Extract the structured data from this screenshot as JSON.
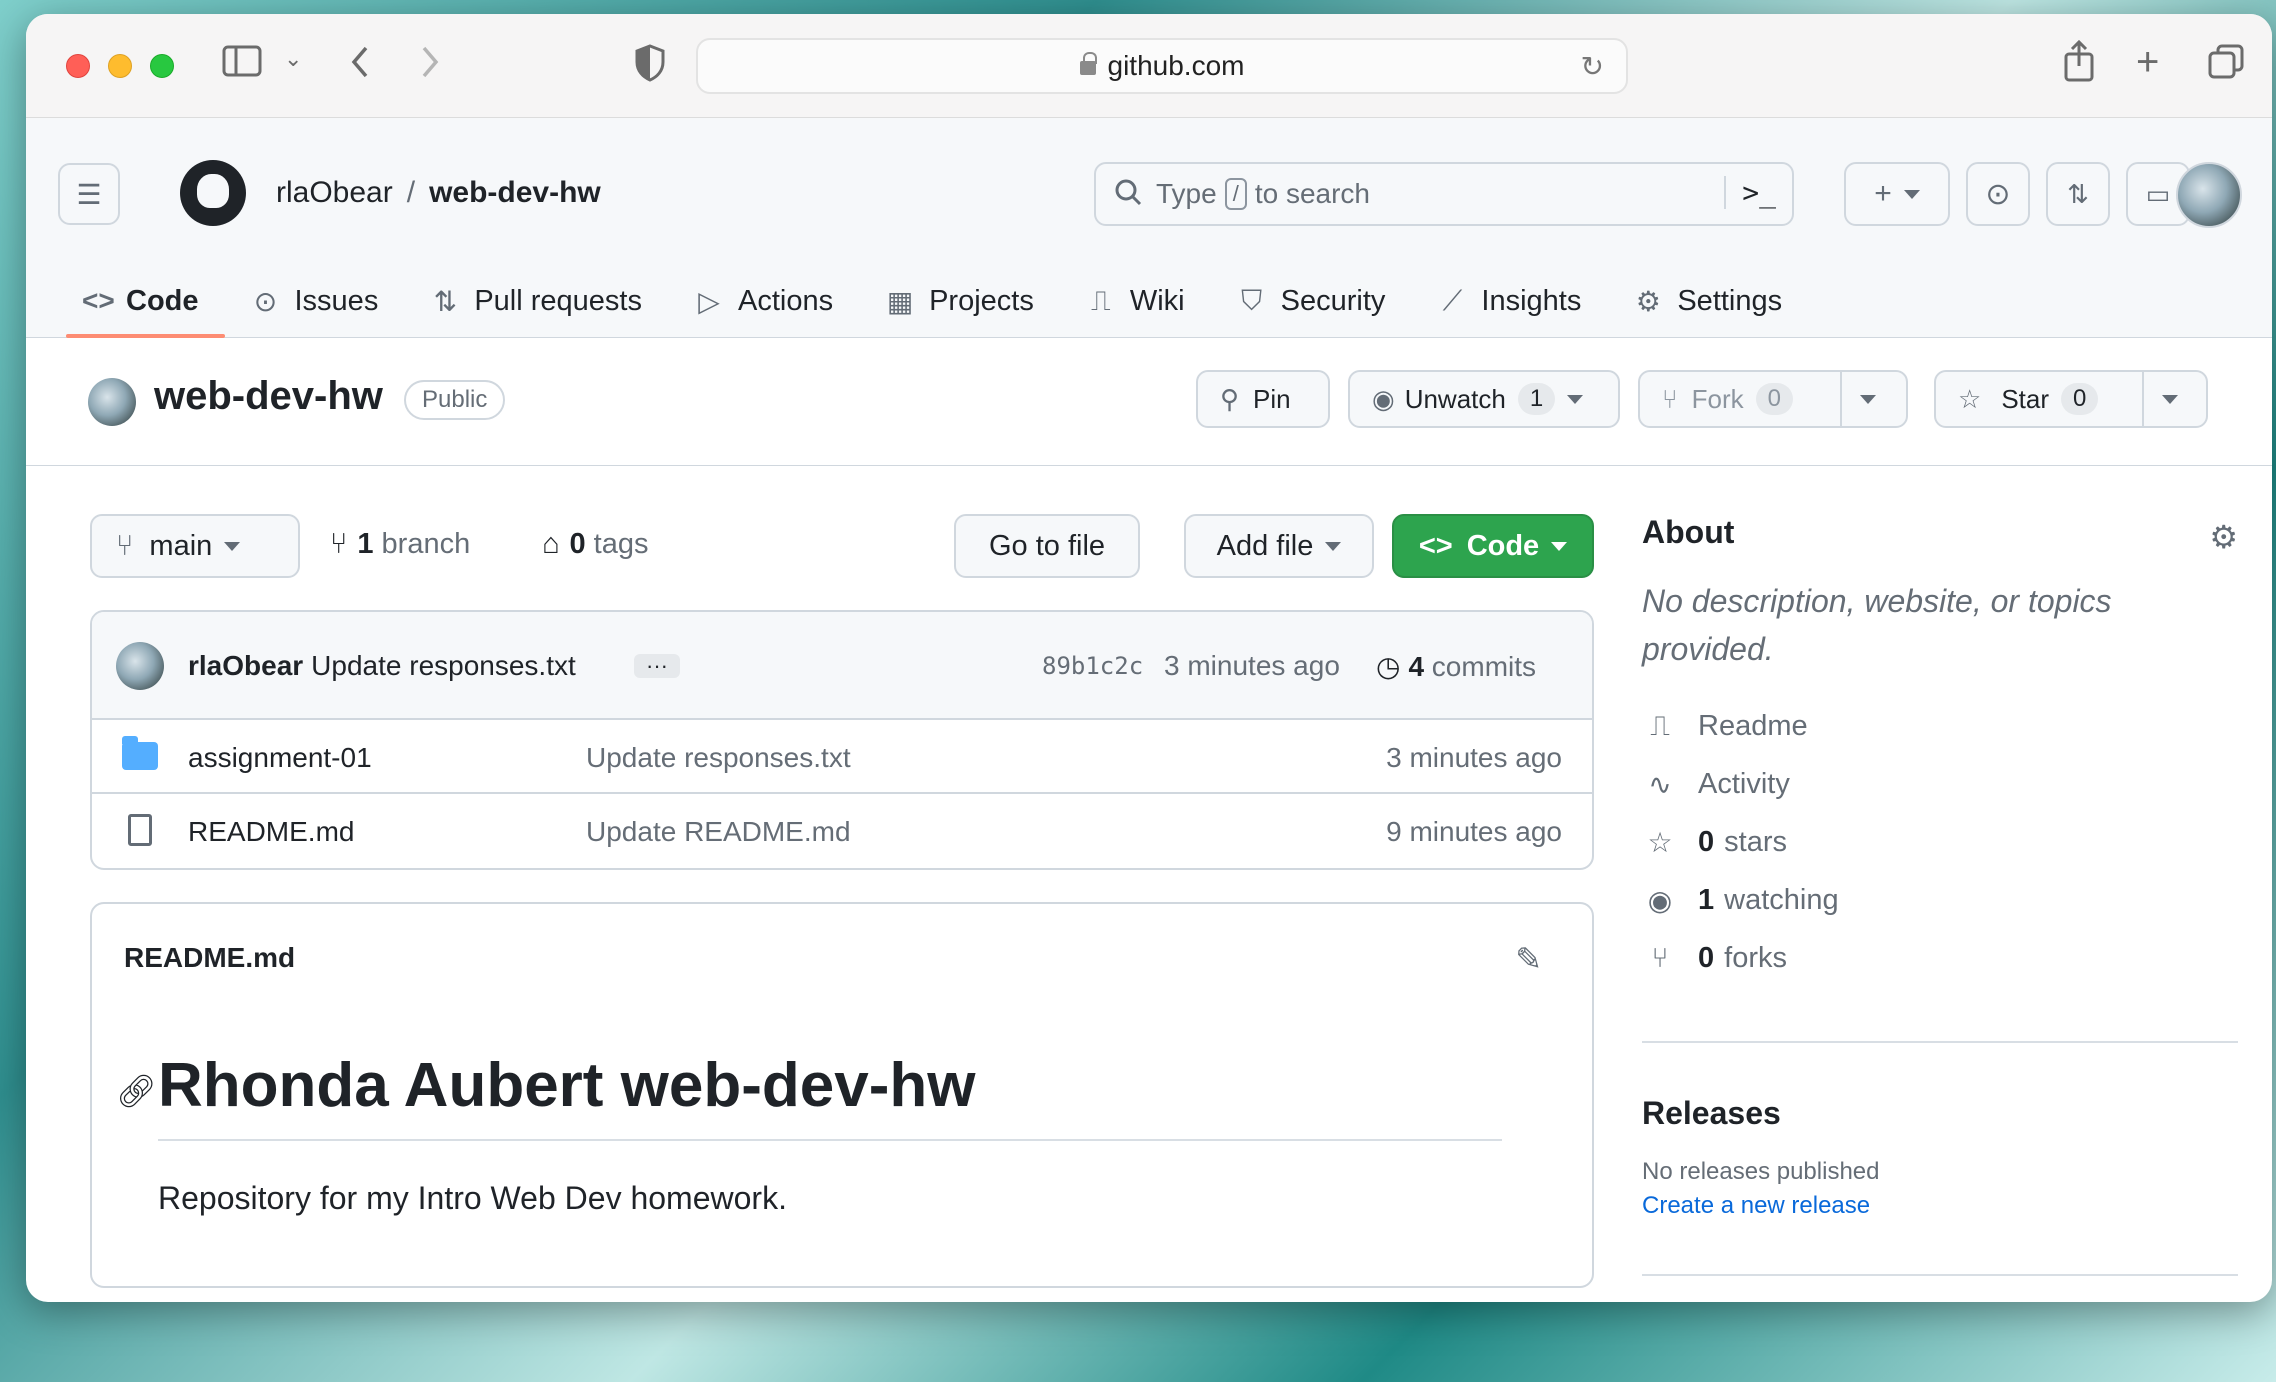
{
  "browser": {
    "url": "github.com"
  },
  "header": {
    "owner": "rlaObear",
    "separator": "/",
    "repo": "web-dev-hw",
    "search_prefix": "Type",
    "search_key": "/",
    "search_suffix": "to search",
    "command_palette": ">_"
  },
  "tabs": [
    {
      "label": "Code",
      "icon": "code-icon"
    },
    {
      "label": "Issues",
      "icon": "issue-icon"
    },
    {
      "label": "Pull requests",
      "icon": "pull-request-icon"
    },
    {
      "label": "Actions",
      "icon": "play-icon"
    },
    {
      "label": "Projects",
      "icon": "table-icon"
    },
    {
      "label": "Wiki",
      "icon": "book-icon"
    },
    {
      "label": "Security",
      "icon": "shield-icon"
    },
    {
      "label": "Insights",
      "icon": "graph-icon"
    },
    {
      "label": "Settings",
      "icon": "gear-icon"
    }
  ],
  "repo_head": {
    "name": "web-dev-hw",
    "visibility": "Public",
    "pin": "Pin",
    "unwatch": "Unwatch",
    "watch_count": "1",
    "fork": "Fork",
    "fork_count": "0",
    "star": "Star",
    "star_count": "0"
  },
  "branch_bar": {
    "branch": "main",
    "branch_count": "1",
    "branch_label": "branch",
    "tag_count": "0",
    "tag_label": "tags",
    "go_to_file": "Go to file",
    "add_file": "Add file",
    "code": "Code"
  },
  "latest_commit": {
    "author": "rlaObear",
    "message": "Update responses.txt",
    "ellipsis": "···",
    "sha": "89b1c2c",
    "ago": "3 minutes ago",
    "commit_count": "4",
    "commit_label": "commits"
  },
  "files": [
    {
      "name": "assignment-01",
      "type": "folder",
      "message": "Update responses.txt",
      "ago": "3 minutes ago"
    },
    {
      "name": "README.md",
      "type": "file",
      "message": "Update README.md",
      "ago": "9 minutes ago"
    }
  ],
  "readme": {
    "filename": "README.md",
    "heading": "Rhonda Aubert web-dev-hw",
    "body": "Repository for my Intro Web Dev homework."
  },
  "about": {
    "title": "About",
    "description": "No description, website, or topics provided.",
    "items": [
      {
        "icon": "book-icon",
        "count": "",
        "label": "Readme"
      },
      {
        "icon": "pulse-icon",
        "count": "",
        "label": "Activity"
      },
      {
        "icon": "star-icon",
        "count": "0",
        "label": "stars"
      },
      {
        "icon": "eye-icon",
        "count": "1",
        "label": "watching"
      },
      {
        "icon": "fork-icon",
        "count": "0",
        "label": "forks"
      }
    ]
  },
  "releases": {
    "title": "Releases",
    "none": "No releases published",
    "create_link": "Create a new release"
  },
  "colors": {
    "accent_green": "#2da44e",
    "tab_underline": "#fd8c73",
    "link_blue": "#0969da"
  }
}
